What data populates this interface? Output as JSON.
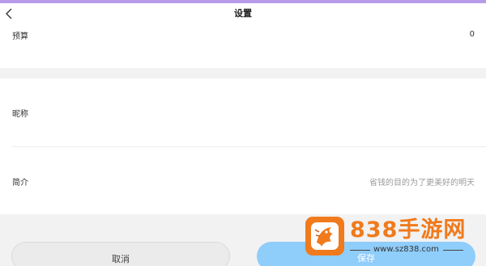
{
  "header": {
    "title": "设置"
  },
  "budget": {
    "label": "预算",
    "value": "0"
  },
  "profile": {
    "nickname_label": "昵称",
    "nickname_value": "",
    "bio_label": "简介",
    "bio_placeholder": "省钱的目的为了更美好的明天"
  },
  "actions": {
    "cancel_label": "取消",
    "save_label": "保存"
  },
  "watermark": {
    "name": "838手游网",
    "url": "www.sz838.com"
  },
  "colors": {
    "accent_bar": "#b79be8",
    "save_button": "#8fcdfb",
    "watermark_brand": "#f07a1c"
  },
  "icons": {
    "back": "chevron-left-icon",
    "watermark": "dragon-logo-icon"
  }
}
